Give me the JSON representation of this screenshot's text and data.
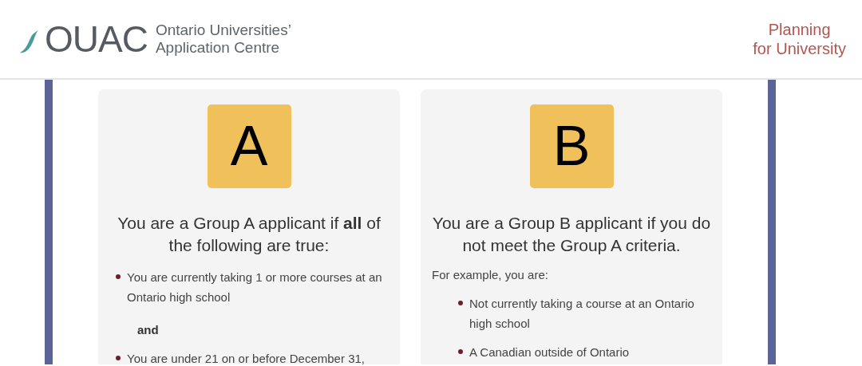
{
  "header": {
    "logo_text": "OUAC",
    "org_name_lines": [
      "Ontario Universities’",
      "Application Centre"
    ],
    "tagline_lines": [
      "Planning",
      "for University"
    ]
  },
  "cards": [
    {
      "letter": "A",
      "heading": "You are a Group A applicant if **all** of the following are true:",
      "blocks": [
        {
          "kind": "bullet",
          "text": "You are currently taking 1 or more courses at an Ontario high school"
        },
        {
          "kind": "conjunction",
          "text": "and"
        },
        {
          "kind": "bullet",
          "text": "You are under 21 on or before December 31,"
        }
      ]
    },
    {
      "letter": "B",
      "heading": "You are a Group B applicant if you do not meet the Group A criteria.",
      "blocks": [
        {
          "kind": "intro",
          "text": "For example, you are:"
        },
        {
          "kind": "indented_bullet",
          "text": "Not currently taking a course at an Ontario high school"
        },
        {
          "kind": "indented_bullet",
          "text": "A Canadian outside of Ontario"
        }
      ]
    }
  ]
}
